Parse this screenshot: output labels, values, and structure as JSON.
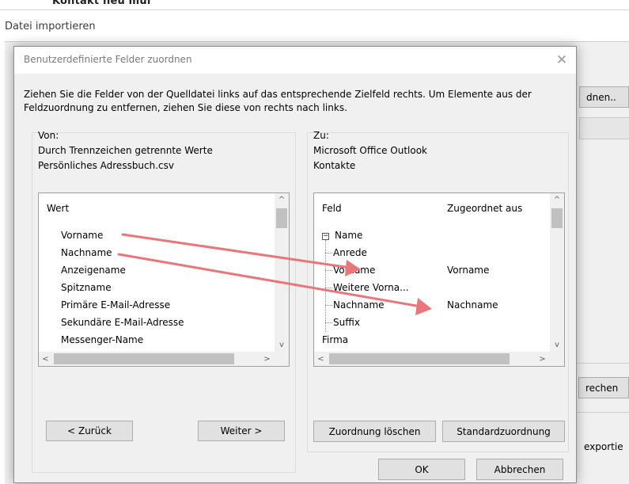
{
  "background": {
    "top_text": "Kontakt neu  mul",
    "window_title": "Datei importieren",
    "right_button_label": "dnen..",
    "right_button2_label": "rechen",
    "right_text": "exportie"
  },
  "dialog": {
    "title": "Benutzerdefinierte Felder zuordnen",
    "close_symbol": "✕",
    "instructions": "Ziehen Sie die Felder von der Quelldatei links auf das entsprechende Zielfeld rechts. Um Elemente aus der Feldzuordnung zu entfernen, ziehen Sie diese von rechts nach links.",
    "from": {
      "label": "Von:",
      "source_type": "Durch Trennzeichen getrennte Werte",
      "source_file": "Persönliches Adressbuch.csv",
      "list_header": "Wert",
      "items": [
        "Vorname",
        "Nachname",
        "Anzeigename",
        "Spitzname",
        "Primäre E-Mail-Adresse",
        "Sekundäre E-Mail-Adresse",
        "Messenger-Name"
      ],
      "back_button": "< Zurück",
      "next_button": "Weiter >"
    },
    "to": {
      "label": "Zu:",
      "target_app": "Microsoft Office Outlook",
      "target_folder": "Kontakte",
      "col_field": "Feld",
      "col_mapped": "Zugeordnet aus",
      "group_name": "Name",
      "group_toggle": "−",
      "rows": [
        {
          "field": "Anrede",
          "mapped": ""
        },
        {
          "field": "Vorname",
          "mapped": "Vorname"
        },
        {
          "field": "Weitere Vorna...",
          "mapped": ""
        },
        {
          "field": "Nachname",
          "mapped": "Nachname"
        },
        {
          "field": "Suffix",
          "mapped": ""
        }
      ],
      "after_group": "Firma",
      "clear_button": "Zuordnung löschen",
      "default_button": "Standardzuordnung"
    },
    "ok_button": "OK",
    "cancel_button": "Abbrechen"
  },
  "scroll_glyphs": {
    "up": "^",
    "down": "v",
    "left": "<",
    "right": ">"
  },
  "colors": {
    "arrow": "#e8767a",
    "dialog_bg": "#f0f0f0",
    "button_bg": "#e1e1e1"
  }
}
